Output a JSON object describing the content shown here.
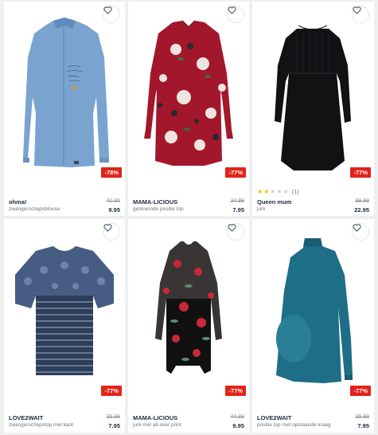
{
  "products": [
    {
      "brand": "ohma!",
      "description": "zwangerschapsblouse",
      "old_price": "40.95",
      "price": "9.95",
      "discount": "-78%",
      "rating_stars": null,
      "rating_count": null,
      "image": "blue-blouse"
    },
    {
      "brand": "MAMA-LICIOUS",
      "description": "gebloemde positie top",
      "old_price": "34.99",
      "price": "7.95",
      "discount": "-77%",
      "rating_stars": null,
      "rating_count": null,
      "image": "red-floral-top"
    },
    {
      "brand": "Queen mum",
      "description": "jurk",
      "old_price": "99.99",
      "price": "22.95",
      "discount": "-77%",
      "rating_stars": 2,
      "rating_count": "(1)",
      "image": "black-dress"
    },
    {
      "brand": "LOVE2WAIT",
      "description": "zwangerschapstop met kant",
      "old_price": "35.99",
      "price": "7.95",
      "discount": "-77%",
      "rating_stars": null,
      "rating_count": null,
      "image": "striped-lace-top"
    },
    {
      "brand": "MAMA-LICIOUS",
      "description": "jurk met all-over print",
      "old_price": "44.99",
      "price": "9.95",
      "discount": "-77%",
      "rating_stars": null,
      "rating_count": null,
      "image": "mesh-floral-dress"
    },
    {
      "brand": "LOVE2WAIT",
      "description": "positie top met opstaande kraag",
      "old_price": "35.99",
      "price": "7.95",
      "discount": "-77%",
      "rating_stars": null,
      "rating_count": null,
      "image": "teal-top"
    }
  ],
  "icons": {
    "favorite": "heart-outline-icon",
    "rating": "star-icon"
  },
  "colors": {
    "discount_badge": "#e2231a",
    "star_filled": "#f5b800",
    "page_bg": "#eeeff1"
  }
}
